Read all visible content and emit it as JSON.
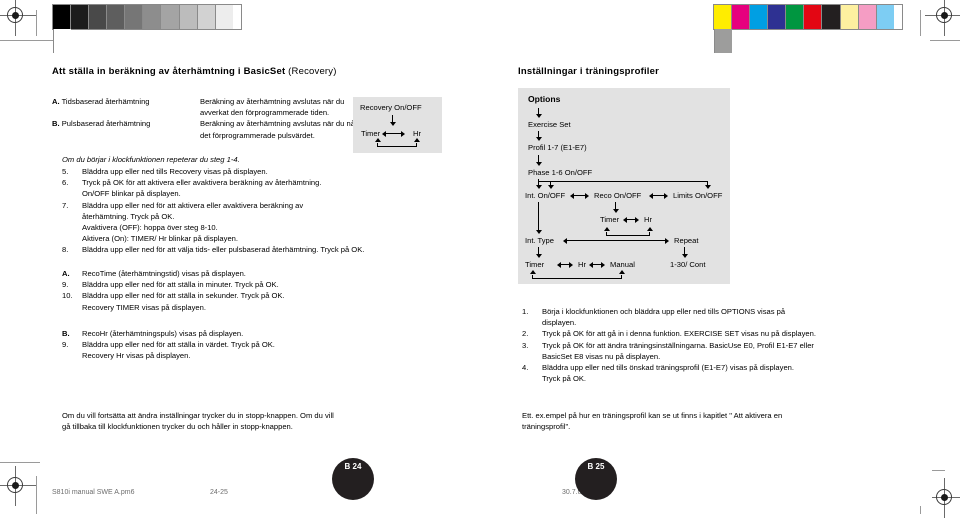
{
  "calibration": {
    "grayscale_steps": [
      "#000000",
      "#1c1c1c",
      "#494949",
      "#5e5e5e",
      "#767676",
      "#8d8d8d",
      "#a4a4a4",
      "#bcbcbc",
      "#d2d2d2",
      "#ededed",
      "#ffffff"
    ],
    "color_steps": [
      "#ffed00",
      "#e6007e",
      "#009fe3",
      "#2e3192",
      "#009640",
      "#e30613",
      "#231f20",
      "#fdf0a0",
      "#f59dc4",
      "#7dcdf3",
      "#9d9d9c"
    ],
    "registration_icon": "registration-target-icon"
  },
  "left_page": {
    "title": "Att ställa in beräkning av återhämtning i BasicSet",
    "title_sub": "(Recovery)",
    "ab_table": [
      {
        "key": "A.",
        "term": "Tidsbaserad återhämtning",
        "desc": "Beräkning av återhämtning avslutas när du avverkat den förprogrammerade tiden."
      },
      {
        "key": "B.",
        "term": "Pulsbaserad återhämtning",
        "desc": "Beräkning av återhämtning avslutas när du når det förprogrammerade pulsvärdet."
      }
    ],
    "note_repeat": "Om du börjar i klockfunktionen repeterar du steg 1-4.",
    "steps": [
      {
        "n": "5.",
        "lines": [
          "Bläddra upp eller ned tills Recovery visas på displayen."
        ]
      },
      {
        "n": "6.",
        "lines": [
          "Tryck på OK för att aktivera eller avaktivera beräkning av återhämtning.",
          "On/OFF blinkar på displayen."
        ]
      },
      {
        "n": "7.",
        "lines": [
          "Bläddra upp eller ned för att aktivera eller avaktivera beräkning av",
          "återhämtning. Tryck på OK.",
          "Avaktivera (OFF): hoppa över steg 8-10.",
          "Aktivera (On): TIMER/ Hr blinkar på displayen."
        ]
      },
      {
        "n": "8.",
        "lines": [
          "Bläddra upp eller ned för att välja tids- eller pulsbaserad återhämtning. Tryck på OK."
        ]
      }
    ],
    "branch_a": {
      "n": "A.",
      "head": "RecoTime (återhämtningstid) visas på displayen.",
      "steps": [
        {
          "n": "9.",
          "lines": [
            "Bläddra upp eller ned för att ställa in minuter. Tryck på OK."
          ]
        },
        {
          "n": "10.",
          "lines": [
            "Bläddra upp eller ned för att ställa in sekunder. Tryck på OK.",
            "Recovery TIMER visas på displayen."
          ]
        }
      ]
    },
    "branch_b": {
      "n": "B.",
      "head": "RecoHr (återhämtningspuls) visas på displayen.",
      "steps": [
        {
          "n": "9.",
          "lines": [
            "Bläddra upp eller ned för att ställa in värdet. Tryck på OK.",
            "Recovery Hr visas på displayen."
          ]
        }
      ]
    },
    "closing": [
      "Om du vill fortsätta att ändra inställningar trycker du in stopp-knappen. Om du vill",
      "gå tillbaka till klockfunktionen trycker du och håller in stopp-knappen."
    ],
    "recovery_diagram": {
      "top": "Recovery On/OFF",
      "left": "Timer",
      "right": "Hr"
    }
  },
  "right_page": {
    "title": "Inställningar i träningsprofiler",
    "options_diagram": {
      "options": "Options",
      "exercise_set": "Exercise Set",
      "profil": "Profil 1-7 (E1-E7)",
      "phase": "Phase 1-6 On/OFF",
      "int_onoff": "Int. On/OFF",
      "reco_onoff": "Reco On/OFF",
      "limits_onoff": "Limits On/OFF",
      "timer_mid": "Timer",
      "hr_mid": "Hr",
      "int_type": "Int. Type",
      "repeat": "Repeat",
      "timer_bot": "Timer",
      "hr_bot": "Hr",
      "manual_bot": "Manual",
      "cont": "1-30/ Cont"
    },
    "steps": [
      {
        "n": "1.",
        "lines": [
          "Börja i klockfunktionen och bläddra upp eller ned tills OPTIONS visas på",
          "displayen."
        ]
      },
      {
        "n": "2.",
        "lines": [
          "Tryck på OK för att gå in i denna funktion. EXERCISE SET visas nu på displayen."
        ]
      },
      {
        "n": "3.",
        "lines": [
          "Tryck på OK för att ändra träningsinställningarna. BasicUse E0, Profil E1-E7 eller",
          "BasicSet E8 visas nu på displayen."
        ]
      },
      {
        "n": "4.",
        "lines": [
          "Bläddra upp eller ned tills önskad träningsprofil (E1-E7) visas på displayen.",
          "Tryck på OK."
        ]
      }
    ],
    "closing": [
      "Ett. ex.empel på hur en träningsprofil kan se ut finns i kapitlet \" Att aktivera en",
      "träningsprofil\"."
    ]
  },
  "footer": {
    "file_name": "S810i manual SWE A.pm6",
    "spread_pages": "24-25",
    "date_stamp": "30.7.02, 14:41",
    "left_page_badge": "B 24",
    "right_page_badge": "B 25"
  }
}
